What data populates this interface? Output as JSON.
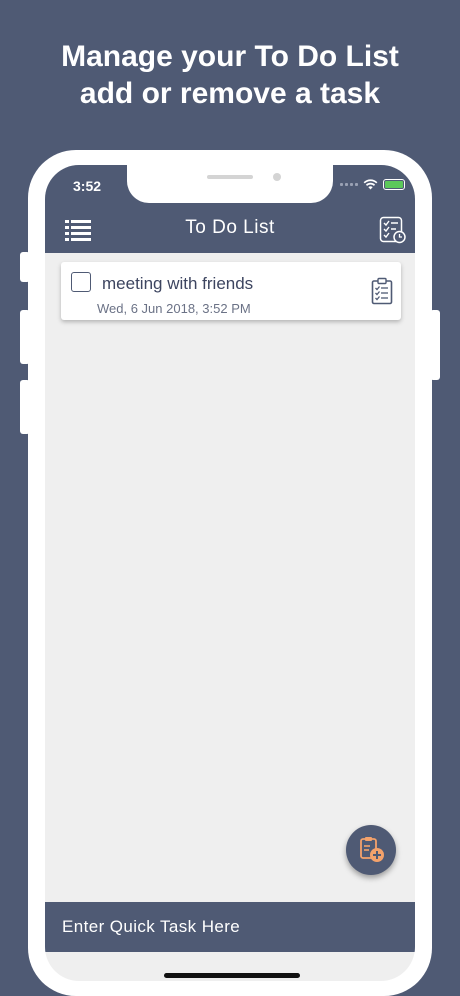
{
  "headline": {
    "line1": "Manage your To Do List",
    "line2": "add or remove a task"
  },
  "status_bar": {
    "time": "3:52",
    "icons": [
      "signal-icon",
      "wifi-icon",
      "battery-charging-icon"
    ]
  },
  "nav": {
    "title": "To Do List",
    "left_icon": "list-menu-icon",
    "right_icon": "checklist-history-icon"
  },
  "tasks": [
    {
      "title": "meeting with friends",
      "date": "Wed, 6 Jun 2018, 3:52 PM",
      "checked": false,
      "icon": "clipboard-checklist-icon"
    }
  ],
  "fab": {
    "icon": "add-task-icon"
  },
  "quick_task": {
    "placeholder": "Enter Quick Task Here"
  },
  "colors": {
    "brand": "#4f5a74",
    "accent": "#f4a26b",
    "background": "#efefef"
  }
}
